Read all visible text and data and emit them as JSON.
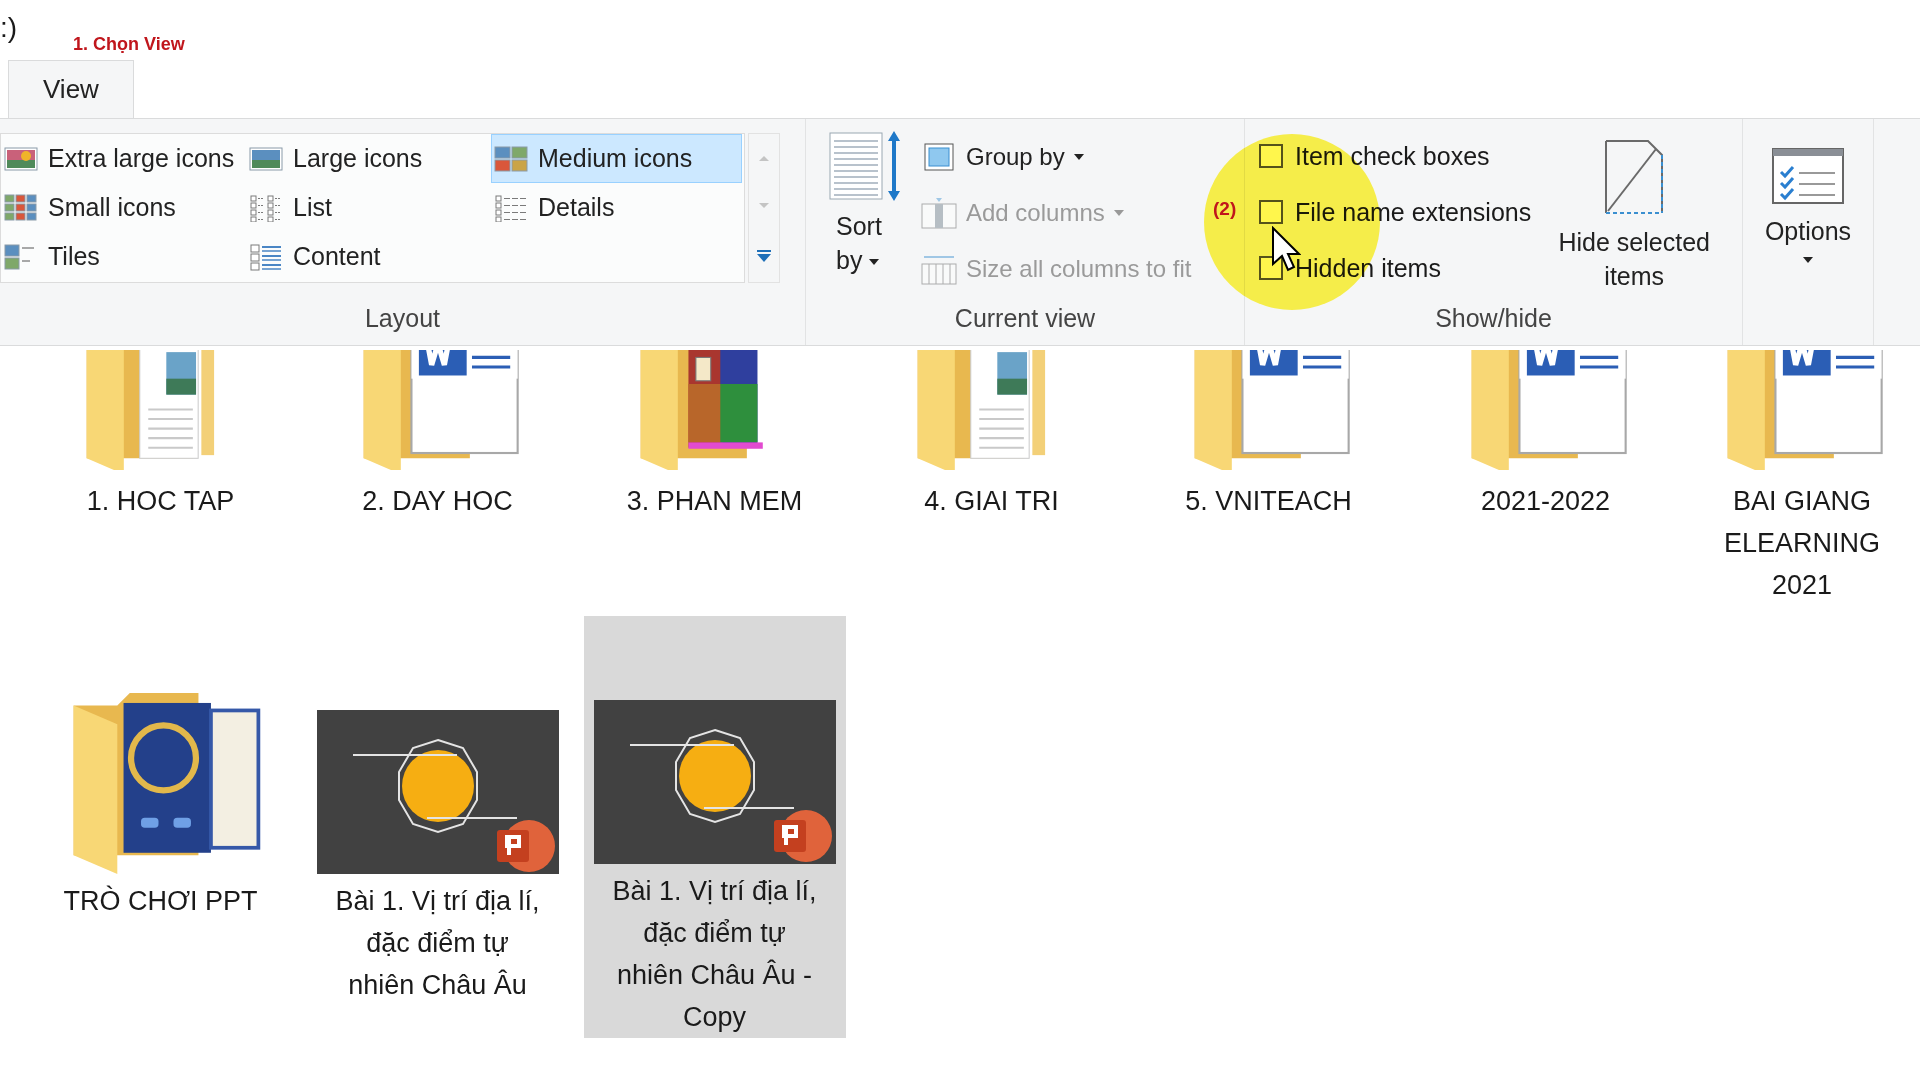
{
  "path_fragment": ":)",
  "annotations": [
    {
      "text": "1. Chọn View",
      "kind": "tab"
    },
    {
      "text": "(2)",
      "kind": "cursor"
    }
  ],
  "tabs": [
    {
      "label": "View",
      "selected": true
    }
  ],
  "ribbon": {
    "layout": {
      "label": "Layout",
      "options": [
        {
          "label": "Extra large icons",
          "selected": false
        },
        {
          "label": "Large icons",
          "selected": false
        },
        {
          "label": "Medium icons",
          "selected": true
        },
        {
          "label": "Small icons",
          "selected": false
        },
        {
          "label": "List",
          "selected": false
        },
        {
          "label": "Details",
          "selected": false
        },
        {
          "label": "Tiles",
          "selected": false
        },
        {
          "label": "Content",
          "selected": false
        }
      ]
    },
    "current_view": {
      "label": "Current view",
      "sort_by": "Sort by",
      "commands": [
        {
          "label": "Group by",
          "disabled": false,
          "dropdown": true
        },
        {
          "label": "Add columns",
          "disabled": true,
          "dropdown": true
        },
        {
          "label": "Size all columns to fit",
          "disabled": true,
          "dropdown": false
        }
      ]
    },
    "show_hide": {
      "label": "Show/hide",
      "checkboxes": [
        {
          "label": "Item check boxes",
          "checked": false
        },
        {
          "label": "File name extensions",
          "checked": false
        },
        {
          "label": "Hidden items",
          "checked": false
        }
      ],
      "hide_selected": "Hide selected items"
    },
    "options": "Options"
  },
  "items": [
    {
      "name": "1. HOC TAP",
      "kind": "docs",
      "selected": false
    },
    {
      "name": "2. DAY HOC",
      "kind": "word",
      "selected": false
    },
    {
      "name": "3. PHAN MEM",
      "kind": "archive",
      "selected": false
    },
    {
      "name": "4. GIAI TRI",
      "kind": "docs",
      "selected": false
    },
    {
      "name": "5. VNITEACH",
      "kind": "word",
      "selected": false
    },
    {
      "name": "2021-2022",
      "kind": "word",
      "selected": false
    },
    {
      "name": "BAI GIANG ELEARNING 2021",
      "kind": "word",
      "selected": false
    },
    {
      "name": "TRÒ CHƠI PPT",
      "kind": "game",
      "selected": false
    },
    {
      "name": "Bài 1. Vị trí địa lí, đặc điểm tự nhiên Châu Âu",
      "kind": "slides",
      "selected": false
    },
    {
      "name": "Bài 1. Vị trí địa lí, đặc điểm tự nhiên Châu Âu - Copy",
      "kind": "slides",
      "selected": true
    }
  ]
}
